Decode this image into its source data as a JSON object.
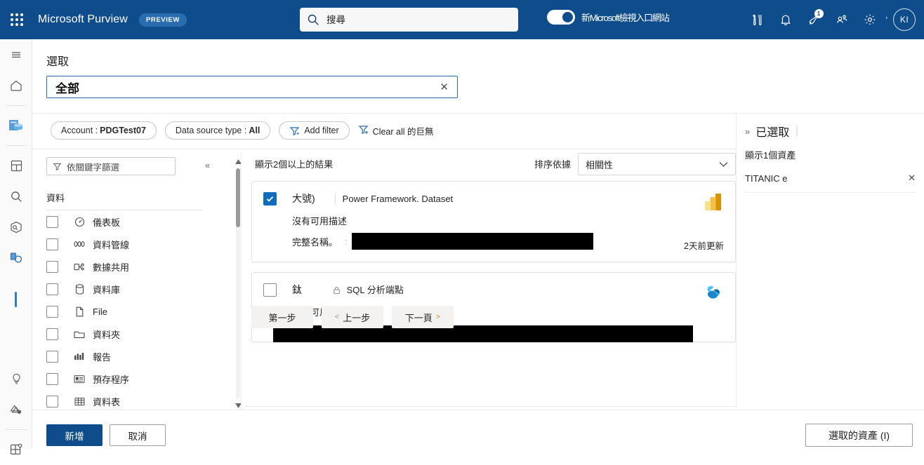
{
  "suitebar": {
    "waffle_icon": "waffle-grid-icon",
    "brand": "Microsoft Purview",
    "preview_badge": "PREVIEW",
    "search_placeholder": "搜尋",
    "search_value": "",
    "toggle_label": "新Microsoft檢視入口網站",
    "icons": [
      {
        "name": "tools-icon",
        "badge": ""
      },
      {
        "name": "bell-icon",
        "badge": ""
      },
      {
        "name": "megaphone-icon",
        "badge": "1"
      },
      {
        "name": "people-community-icon",
        "badge": ""
      },
      {
        "name": "gear-icon",
        "badge": ""
      }
    ],
    "apostrophe": "'",
    "avatar_initials": "KI"
  },
  "rail": {
    "items": [
      {
        "name": "hamburger-menu-icon"
      },
      {
        "name": "home-icon"
      },
      {
        "name": "data-map-icon"
      },
      {
        "name": "data-catalog-icon"
      },
      {
        "name": "search-icon"
      },
      {
        "name": "data-products-icon"
      },
      {
        "name": "data-estate-icon"
      },
      {
        "name": "insights-idea-icon"
      },
      {
        "name": "data-sharing-icon"
      },
      {
        "name": "solutions-grid-icon"
      }
    ]
  },
  "page": {
    "title": "選取",
    "search_value": "全部",
    "search_clear": "✕"
  },
  "filters": {
    "chips": [
      {
        "label": "Account :",
        "value": "PDGTest07",
        "icon": ""
      },
      {
        "label": "Data source type :",
        "value": "All",
        "icon": ""
      },
      {
        "label": "Add filter",
        "value": "",
        "icon": "filter-add-icon"
      }
    ],
    "clear_all": "Clear all 的巨無"
  },
  "facets": {
    "keyword_placeholder": "依關鍵字篩選",
    "collapse_icon": "«",
    "group_title": "資料",
    "items": [
      {
        "label": "儀表板",
        "icon": "dashboard-icon",
        "checked": false
      },
      {
        "label": "資料管線",
        "icon": "pipeline-icon",
        "checked": false
      },
      {
        "label": "數據共用",
        "icon": "data-share-icon",
        "checked": false
      },
      {
        "label": "資料庫",
        "icon": "database-icon",
        "checked": false
      },
      {
        "label": "File",
        "icon": "file-icon",
        "checked": false
      },
      {
        "label": "資料夾",
        "icon": "folder-icon",
        "checked": false
      },
      {
        "label": "報告",
        "icon": "report-icon",
        "checked": false
      },
      {
        "label": "預存程序",
        "icon": "stored-procedure-icon",
        "checked": false
      },
      {
        "label": "資料表",
        "icon": "table-icon",
        "checked": false
      }
    ]
  },
  "results": {
    "count_text": "顯示2個以上的結果",
    "sort_label": "排序依據",
    "sort_value": "相關性",
    "cards": [
      {
        "checked": true,
        "name": "大號)",
        "type": "Power Framework. Dataset",
        "type_icon": "",
        "description": "沒有可用描述",
        "fullname_label": "完整名稱。",
        "fullname_value": "",
        "updated": "2天前更新",
        "logo": "power-bi-icon"
      },
      {
        "checked": false,
        "name": "鈦",
        "type": "SQL 分析端點",
        "type_icon": "lock-icon",
        "description": "沒有可用描述",
        "fullname_label": "",
        "fullname_value": "",
        "updated": "",
        "logo": "microsoft-fabric-icon"
      }
    ]
  },
  "pager": {
    "first": "第一步",
    "prev": "上一步",
    "prev_arrow": "<",
    "next": "下一頁",
    "next_arrow": ">"
  },
  "selected_panel": {
    "chevron": "»",
    "title": "已選取",
    "count_text": "顯示1個資產",
    "items": [
      {
        "name": "TITANIC e",
        "remove": "✕"
      }
    ]
  },
  "footer": {
    "add": "新增",
    "cancel": "取消",
    "selected_assets": "選取的資產 (I)"
  },
  "colors": {
    "brand_blue": "#0f4c8b",
    "accent_blue": "#0f6cbd",
    "rail_active": "#2b7cd3"
  }
}
